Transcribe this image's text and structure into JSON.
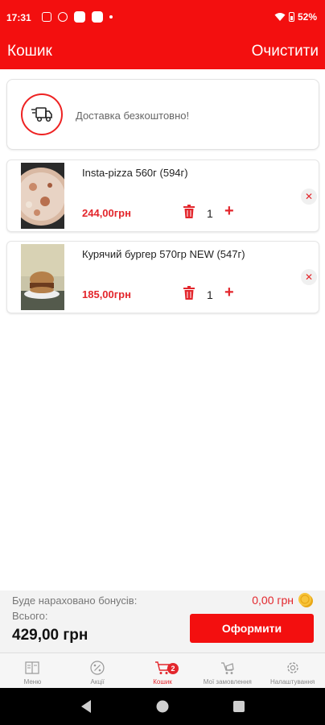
{
  "status_bar": {
    "time": "17:31",
    "battery": "52%"
  },
  "app_bar": {
    "title": "Кошик",
    "clear_label": "Очистити"
  },
  "delivery": {
    "text": "Доставка безкоштовно!"
  },
  "cart_items": [
    {
      "name": "Insta-pizza 560г (594г)",
      "price": "244,00грн",
      "quantity": "1"
    },
    {
      "name": "Курячий бургер 570гр NEW (547г)",
      "price": "185,00грн",
      "quantity": "1"
    }
  ],
  "summary": {
    "bonus_label": "Буде нараховано бонусів:",
    "bonus_value": "0,00 грн",
    "total_label": "Всього:",
    "total_value": "429,00 грн",
    "checkout_label": "Оформити"
  },
  "bottom_nav": {
    "items": [
      {
        "label": "Меню",
        "icon": "menu-book-icon"
      },
      {
        "label": "Акції",
        "icon": "percent-icon"
      },
      {
        "label": "Кошик",
        "icon": "cart-icon",
        "badge": "2"
      },
      {
        "label": "Мої замовлення",
        "icon": "orders-icon"
      },
      {
        "label": "Налаштування",
        "icon": "gear-icon"
      }
    ]
  },
  "colors": {
    "brand": "#f30f0f",
    "accent_text": "#e3262c"
  }
}
